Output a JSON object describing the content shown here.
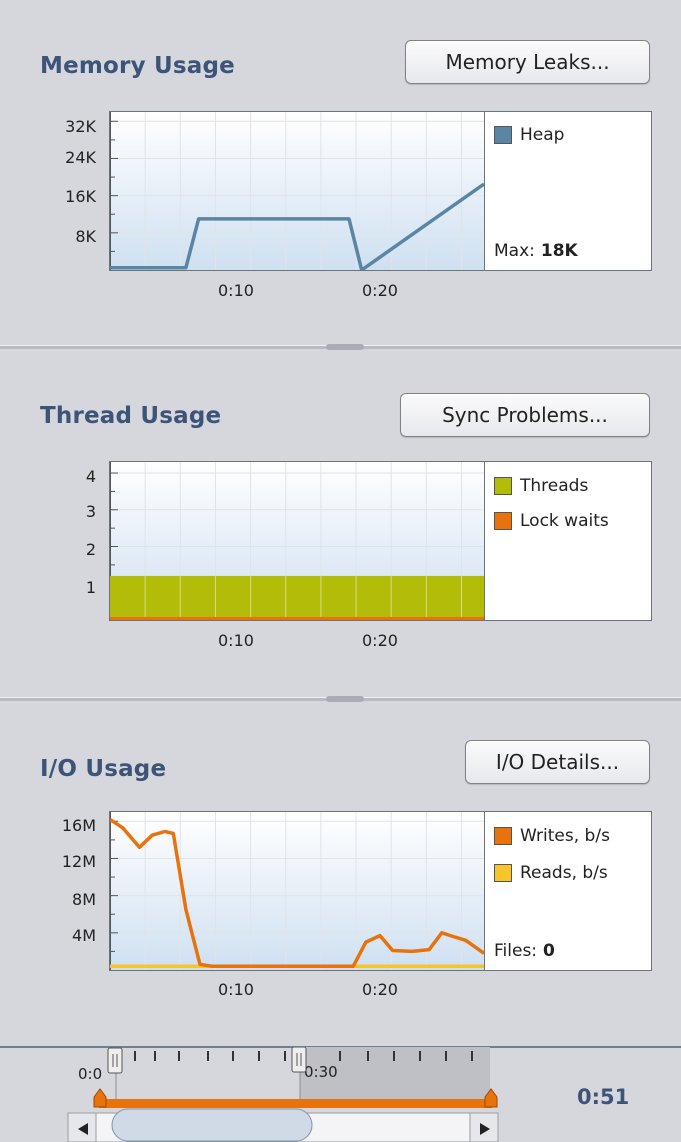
{
  "memory": {
    "title": "Memory Usage",
    "button": "Memory Leaks...",
    "y_ticks": [
      "32K",
      "24K",
      "16K",
      "8K"
    ],
    "x_ticks": [
      "0:10",
      "0:20"
    ],
    "legend": [
      {
        "label": "Heap",
        "color": "#5a86a6"
      }
    ],
    "stat_label": "Max:",
    "stat_value": "18K"
  },
  "threads": {
    "title": "Thread Usage",
    "button": "Sync Problems...",
    "y_ticks": [
      "4",
      "3",
      "2",
      "1"
    ],
    "x_ticks": [
      "0:10",
      "0:20"
    ],
    "legend": [
      {
        "label": "Threads",
        "color": "#b3bd09"
      },
      {
        "label": "Lock waits",
        "color": "#e8720c"
      }
    ]
  },
  "io": {
    "title": "I/O Usage",
    "button": "I/O Details...",
    "y_ticks": [
      "16M",
      "12M",
      "8M",
      "4M"
    ],
    "x_ticks": [
      "0:10",
      "0:20"
    ],
    "legend": [
      {
        "label": "Writes, b/s",
        "color": "#e8720c"
      },
      {
        "label": "Reads, b/s",
        "color": "#f8c42c"
      }
    ],
    "stat_label": "Files:",
    "stat_value": "0"
  },
  "timeline": {
    "start_label": "0:0",
    "mark_label": "0:30",
    "duration": "0:51"
  },
  "colors": {
    "accent_orange": "#e8720c",
    "heap_blue": "#5a86a6",
    "threads_green": "#b3bd09",
    "reads_yellow": "#f8c42c",
    "title_blue": "#3b5478"
  },
  "chart_data": [
    {
      "type": "line",
      "title": "Memory Usage",
      "x": [
        0,
        0.5,
        5.4,
        6.3,
        16.4,
        17.0,
        17.9,
        26.6
      ],
      "series": [
        {
          "name": "Heap",
          "values": [
            0.5,
            0.5,
            0.5,
            11,
            11,
            11,
            0,
            18.5
          ]
        }
      ],
      "xlim": [
        0,
        26.6
      ],
      "ylim": [
        0,
        34
      ],
      "yunit": "K",
      "y_ticks": [
        8,
        16,
        24,
        32
      ],
      "x_ticks": [
        10,
        20
      ]
    },
    {
      "type": "area",
      "title": "Thread Usage",
      "x": [
        0,
        26.6
      ],
      "series": [
        {
          "name": "Threads",
          "values": [
            1.2,
            1.2
          ]
        },
        {
          "name": "Lock waits",
          "values": [
            0.05,
            0.05
          ]
        }
      ],
      "xlim": [
        0,
        26.6
      ],
      "ylim": [
        0,
        4.3
      ],
      "y_ticks": [
        1,
        2,
        3,
        4
      ],
      "x_ticks": [
        10,
        20
      ]
    },
    {
      "type": "line",
      "title": "I/O Usage",
      "x": [
        0,
        0.9,
        2.1,
        3.0,
        3.9,
        4.5,
        5.4,
        6.4,
        7.3,
        17.3,
        18.2,
        19.2,
        20.1,
        21.5,
        22.7,
        23.6,
        24.4,
        25.3,
        26.6
      ],
      "series": [
        {
          "name": "Writes, b/s",
          "values": [
            16.2,
            15.3,
            13.2,
            14.5,
            14.9,
            14.7,
            6.5,
            0.6,
            0.4,
            0.4,
            3.0,
            3.7,
            2.1,
            2.0,
            2.2,
            4.0,
            3.6,
            3.2,
            1.8
          ]
        },
        {
          "name": "Reads, b/s",
          "values": [
            0.4,
            0.4,
            0.4,
            0.4,
            0.4,
            0.4,
            0.4,
            0.4,
            0.4,
            0.4,
            0.4,
            0.4,
            0.4,
            0.4,
            0.4,
            0.4,
            0.4,
            0.4,
            0.4
          ]
        }
      ],
      "xlim": [
        0,
        26.6
      ],
      "ylim": [
        0,
        17
      ],
      "yunit": "M",
      "y_ticks": [
        4,
        8,
        12,
        16
      ],
      "x_ticks": [
        10,
        20
      ]
    }
  ]
}
